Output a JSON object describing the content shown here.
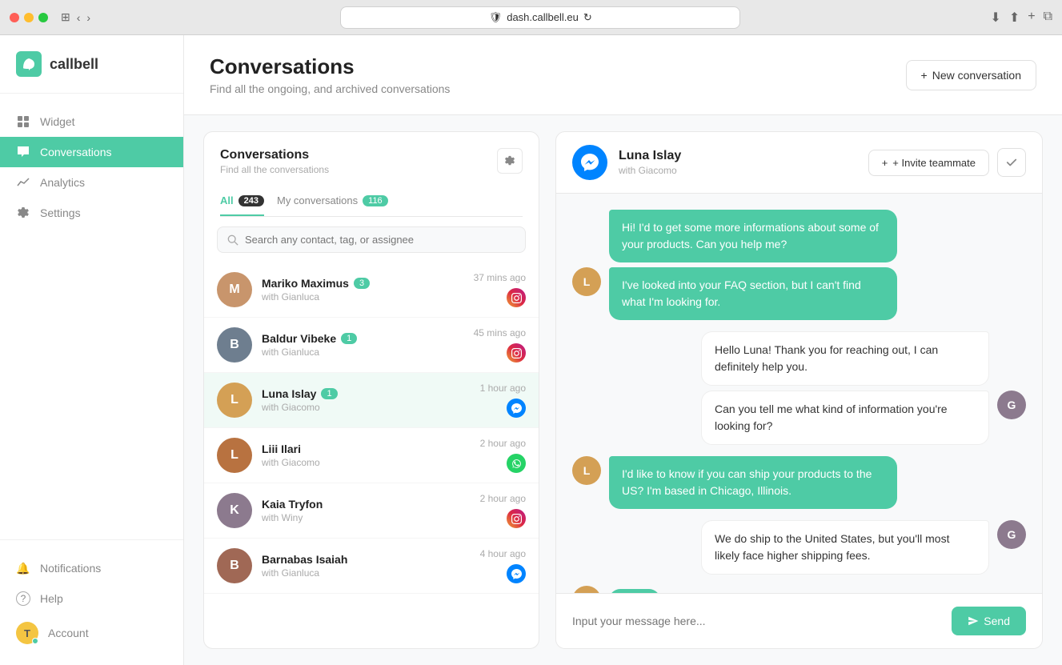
{
  "browser": {
    "url": "dash.callbell.eu",
    "shield_icon": "🛡",
    "reload_icon": "↻"
  },
  "app": {
    "logo": "callbell",
    "logo_icon": "✦"
  },
  "sidebar": {
    "items": [
      {
        "id": "widget",
        "label": "Widget",
        "icon": "□"
      },
      {
        "id": "conversations",
        "label": "Conversations",
        "icon": "💬",
        "active": true
      },
      {
        "id": "analytics",
        "label": "Analytics",
        "icon": "~"
      },
      {
        "id": "settings",
        "label": "Settings",
        "icon": "⚙"
      }
    ],
    "bottom_items": [
      {
        "id": "notifications",
        "label": "Notifications",
        "icon": "🔔"
      },
      {
        "id": "help",
        "label": "Help",
        "icon": "?"
      },
      {
        "id": "account",
        "label": "Account",
        "icon": "T",
        "avatar_color": "#f4c542"
      }
    ]
  },
  "main_header": {
    "title": "Conversations",
    "subtitle": "Find all the ongoing, and archived conversations",
    "new_conversation_button": "+ New conversation"
  },
  "conversations_panel": {
    "title": "Conversations",
    "subtitle": "Find all the conversations",
    "gear_icon": "⚙",
    "tabs": [
      {
        "id": "all",
        "label": "All",
        "count": "243",
        "active": true
      },
      {
        "id": "my",
        "label": "My conversations",
        "count": "116",
        "active": false
      }
    ],
    "search_placeholder": "Search any contact, tag, or assignee",
    "conversations": [
      {
        "id": 1,
        "name": "Mariko Maximus",
        "assignee": "with Gianluca",
        "badge": "3",
        "time": "37 mins ago",
        "channel": "instagram",
        "avatar_color": "#e8a87c",
        "avatar_letter": "M"
      },
      {
        "id": 2,
        "name": "Baldur Vibeke",
        "assignee": "with Gianluca",
        "badge": "1",
        "time": "45 mins ago",
        "channel": "instagram",
        "avatar_color": "#7e8d9f",
        "avatar_letter": "B"
      },
      {
        "id": 3,
        "name": "Luna Islay",
        "assignee": "with Giacomo",
        "badge": "1",
        "time": "1 hour ago",
        "channel": "messenger",
        "avatar_color": "#d4a96a",
        "avatar_letter": "L",
        "active": true
      },
      {
        "id": 4,
        "name": "Liii Ilari",
        "assignee": "with Giacomo",
        "badge": null,
        "time": "2 hour ago",
        "channel": "whatsapp",
        "avatar_color": "#c17f4a",
        "avatar_letter": "L"
      },
      {
        "id": 5,
        "name": "Kaia Tryfon",
        "assignee": "with Winy",
        "badge": null,
        "time": "2 hour ago",
        "channel": "instagram",
        "avatar_color": "#9b8ea0",
        "avatar_letter": "K"
      },
      {
        "id": 6,
        "name": "Barnabas Isaiah",
        "assignee": "with Gianluca",
        "badge": null,
        "time": "4 hour ago",
        "channel": "messenger",
        "avatar_color": "#b87c6a",
        "avatar_letter": "B"
      }
    ]
  },
  "chat": {
    "contact_name": "Luna Islay",
    "contact_sub": "with Giacomo",
    "channel": "messenger",
    "invite_button": "+ Invite teammate",
    "check_icon": "✓",
    "messages": [
      {
        "id": 1,
        "type": "incoming",
        "text": "Hi! I'd to get some more informations about some of your products. Can you help me?",
        "has_avatar": false
      },
      {
        "id": 2,
        "type": "incoming",
        "text": "I've looked into your FAQ section, but I can't find what I'm looking for.",
        "has_avatar": true,
        "avatar_color": "#d4a96a",
        "avatar_letter": "L"
      },
      {
        "id": 3,
        "type": "outgoing",
        "text": "Hello Luna! Thank you for reaching out, I can definitely help you.",
        "has_avatar": false
      },
      {
        "id": 4,
        "type": "outgoing",
        "text": "Can you tell me what kind of information you're looking for?",
        "has_avatar": true,
        "avatar_color": "#9b8ea0",
        "avatar_letter": "G"
      },
      {
        "id": 5,
        "type": "incoming",
        "text": "I'd like to know if you can ship your products to the US? I'm based in Chicago, Illinois.",
        "has_avatar": true,
        "avatar_color": "#d4a96a",
        "avatar_letter": "L"
      },
      {
        "id": 6,
        "type": "outgoing",
        "text": "We do ship to the United States, but you'll most likely face higher shipping fees.",
        "has_avatar": true,
        "avatar_color": "#9b8ea0",
        "avatar_letter": "G"
      },
      {
        "id": 7,
        "type": "typing",
        "has_avatar": true,
        "avatar_color": "#d4a96a",
        "avatar_letter": "L"
      }
    ],
    "input_placeholder": "Input your message here...",
    "send_button": "Send"
  }
}
